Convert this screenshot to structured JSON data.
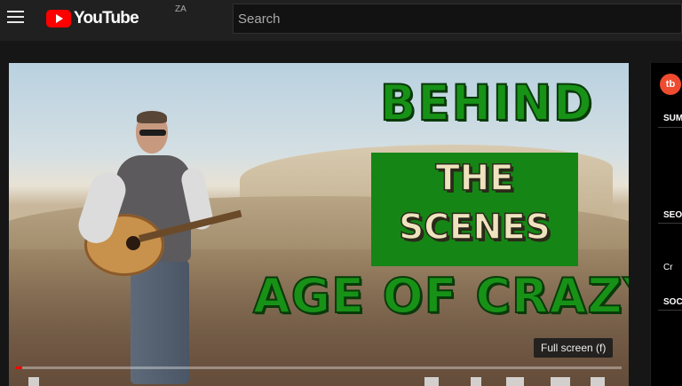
{
  "header": {
    "logo_text": "YouTube",
    "region": "ZA",
    "search_placeholder": "Search"
  },
  "video": {
    "overlay_lines": [
      "BEHIND",
      "THE",
      "SCENES",
      "AGE OF CRAZY"
    ],
    "tooltip": "Full screen (f)",
    "progress_fraction": 0.01
  },
  "side_panel": {
    "icon_text": "tb",
    "labels": [
      "SUM",
      "SEO",
      "Cr",
      "SOC"
    ]
  },
  "colors": {
    "brand_red": "#ff0000",
    "title_green": "#179217",
    "title_cream": "#efe3bf",
    "tubebuddy_orange": "#ef4c2f"
  }
}
